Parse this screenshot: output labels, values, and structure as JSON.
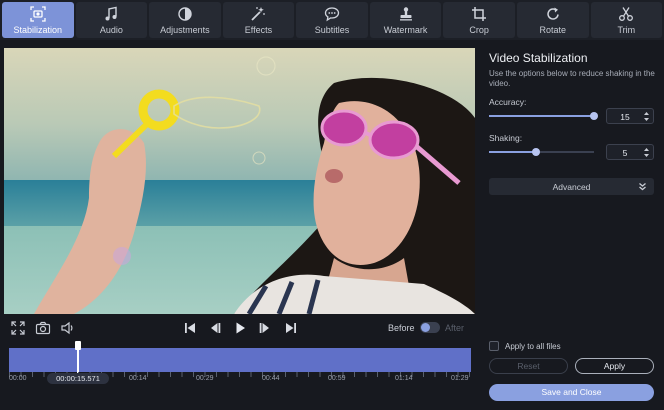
{
  "tabs": [
    {
      "label": "Stabilization",
      "icon": "stabilization-icon",
      "active": true
    },
    {
      "label": "Audio",
      "icon": "music-note-icon",
      "active": false
    },
    {
      "label": "Adjustments",
      "icon": "contrast-icon",
      "active": false
    },
    {
      "label": "Effects",
      "icon": "magic-wand-icon",
      "active": false
    },
    {
      "label": "Subtitles",
      "icon": "speech-bubble-icon",
      "active": false
    },
    {
      "label": "Watermark",
      "icon": "stamp-icon",
      "active": false
    },
    {
      "label": "Crop",
      "icon": "crop-icon",
      "active": false
    },
    {
      "label": "Rotate",
      "icon": "rotate-icon",
      "active": false
    },
    {
      "label": "Trim",
      "icon": "scissors-icon",
      "active": false
    }
  ],
  "player": {
    "before_label": "Before",
    "after_label": "After",
    "compare_enabled": false
  },
  "timeline": {
    "current_time": "00:00:15.571",
    "ticks": [
      "00:00",
      "00:14",
      "00:29",
      "00:44",
      "00:59",
      "01:14",
      "01:29",
      "01:43"
    ]
  },
  "panel": {
    "title": "Video Stabilization",
    "description": "Use the options below to reduce shaking in the video.",
    "accuracy": {
      "label": "Accuracy:",
      "value": "15",
      "max": 15
    },
    "shaking": {
      "label": "Shaking:",
      "value": "5",
      "max": 10
    },
    "advanced_label": "Advanced",
    "apply_all_label": "Apply to all files",
    "apply_all_checked": false,
    "reset_label": "Reset",
    "apply_label": "Apply",
    "save_label": "Save and Close"
  },
  "colors": {
    "accent": "#7d93d8",
    "timeline": "#6070c8",
    "background": "#17191f"
  }
}
